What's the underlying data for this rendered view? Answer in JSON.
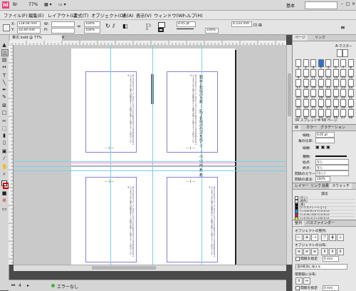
{
  "app": {
    "logo": "Id",
    "zoom": "77%",
    "workspace": "基本",
    "window_controls": [
      "–",
      "□",
      "×"
    ]
  },
  "menu": [
    {
      "label": "ファイル(F)"
    },
    {
      "label": "編集(E)"
    },
    {
      "label": "レイアウト(L)"
    },
    {
      "label": "書式(T)"
    },
    {
      "label": "オブジェクト(O)"
    },
    {
      "label": "表(A)"
    },
    {
      "label": "表示(V)"
    },
    {
      "label": "ウィンドウ(W)"
    },
    {
      "label": "ヘルプ(H)"
    }
  ],
  "control": {
    "x_label": "X:",
    "x_value": "118.04 mm",
    "y_label": "Y:",
    "y_value": "10.49 mm",
    "w_label": "W:",
    "w_value": "",
    "h_label": "H:",
    "h_value": "",
    "scale_x": "100%",
    "scale_y": "100%",
    "stroke_weight": "0.05 pt",
    "opacity": "100%",
    "inset": "4.233 mm"
  },
  "document": {
    "tab_label": "車次.indd @ 77%",
    "page_numbers": [
      "— 2 —",
      "— 1 —",
      "— 3 —",
      "— 1 —"
    ],
    "title_text": "種苗と栽培の予察 ― 県下各地の作況を巡りて ―  小 山 田 秀 義",
    "body_sample": "あいうえおかきくけこさしすせそたちつてとなにぬねのはひふへほまみむめもやゆよらりるれろわをん本文の組版見本として縦組で配置した段落テキストが続いています。"
  },
  "status": {
    "page": "4",
    "preflight": "エラーなし"
  },
  "panels": {
    "pages_tab": "ページ",
    "links_tab": "リンク",
    "pages_footer": "34 スプレッド中 68 ページ",
    "master_label": "A-マスター",
    "page_numbers": [
      "1",
      "2",
      "3",
      "4",
      "5",
      "6",
      "7",
      "8",
      "9",
      "10",
      "11",
      "12",
      "13",
      "14",
      "15",
      "16",
      "17",
      "18",
      "19",
      "20",
      "21",
      "22",
      "23",
      "24",
      "25",
      "26",
      "27",
      "28",
      "29",
      "30",
      "31",
      "32",
      "33",
      "34",
      "35",
      "36",
      "37",
      "38",
      "39",
      "40",
      "41",
      "42",
      "43",
      "44",
      "45",
      "46",
      "47",
      "48"
    ],
    "stroke_tab": "線",
    "color_tab": "カラー",
    "gradient_tab": "グラデーション",
    "stroke_weight_label": "線幅:",
    "stroke_weight": "0.05 pt",
    "miter_label": "角の比率:",
    "cap_label": "線端:",
    "type_label": "種類:",
    "start_label": "始点:",
    "start_value": "なし",
    "end_label": "終点:",
    "end_value": "なし",
    "gap_color_label": "間隔のカラー:",
    "gap_color_value": "[なし]",
    "gap_tint_label": "間隔の濃淡:",
    "gap_tint_value": "100%",
    "swatch_tabs": [
      "レイヤー",
      "リンク",
      "効果",
      "スウォッチ"
    ],
    "swatch_tint": "濃淡",
    "swatches": [
      {
        "name": "[なし]",
        "color": "#ffffff"
      },
      {
        "name": "[紙色]",
        "color": "#ffffff"
      },
      {
        "name": "[黒]",
        "color": "#000000"
      },
      {
        "name": "[レジストレーション]",
        "color": "#000000"
      },
      {
        "name": "C=100 M=0 Y=0 K=0",
        "color": "#00a0e9"
      },
      {
        "name": "C=0 M=100 Y=0 K=0",
        "color": "#e4007f"
      },
      {
        "name": "C=0 M=0 Y=100 K=0",
        "color": "#fff100"
      }
    ],
    "align_tabs": [
      "整列",
      "パスファインダー"
    ],
    "align_objects_label": "オブジェクトの整列:",
    "distribute_objects_label": "オブジェクトの分布:",
    "use_spacing_label": "間隔を指定",
    "spacing_value": "0 mm",
    "align_to_label": "選択範囲に揃える",
    "distribute_spacing_label": "等間隔に分布:",
    "spacing_value2": "0 mm"
  },
  "colors": {
    "guide": "#7ccfe6",
    "frame": "#8a80d6",
    "margin": "#e08fb4",
    "page_list_selected": "#2f6fd6"
  }
}
